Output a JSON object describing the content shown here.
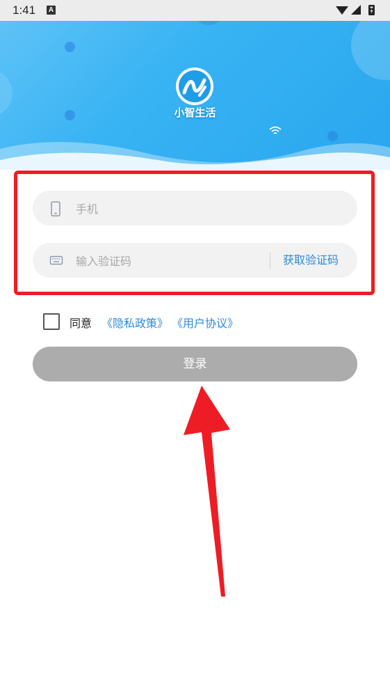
{
  "status_bar": {
    "time": "1:41",
    "notification_letter": "A"
  },
  "header": {
    "app_name": "小智生活"
  },
  "form": {
    "phone_placeholder": "手机",
    "code_placeholder": "输入验证码",
    "get_code_label": "获取验证码"
  },
  "agreement": {
    "agree_label": "同意",
    "privacy_link": "《隐私政策》",
    "user_agreement_link": "《用户协议》"
  },
  "login": {
    "label": "登录"
  },
  "colors": {
    "accent": "#2a8bdc",
    "header_blue": "#38b3f3",
    "button_disabled": "#acacac",
    "annotation_red": "#ee1c25"
  }
}
